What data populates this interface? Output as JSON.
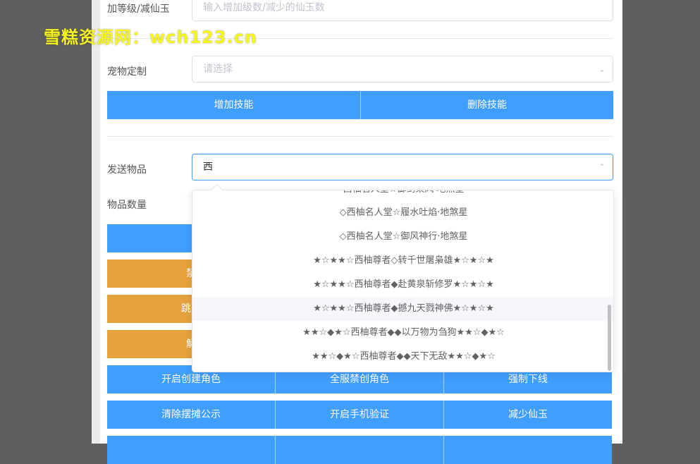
{
  "form": {
    "level_label": "加等级/减仙玉",
    "level_placeholder": "输入增加级数/减少的仙玉数",
    "pet_label": "宠物定制",
    "pet_placeholder": "请选择",
    "add_skill": "增加技能",
    "delete_skill": "删除技能",
    "send_item_label": "发送物品",
    "send_item_value": "西",
    "item_qty_label": "物品数量"
  },
  "dropdown": {
    "options": [
      "西柚名人堂☆御剑乘风·地煞星",
      "◇西柚名人堂☆履水吐焰·地煞星",
      "◇西柚名人堂☆御风神行·地煞星",
      "★☆★★☆西柚尊者◇转千世屠枭雄★☆★☆★",
      "★☆★★☆西柚尊者◆赴黄泉斩修罗★☆★☆★",
      "★☆★★☆西柚尊者◆撼九天戮神佛★☆★☆★",
      "★★☆◆★☆西柚尊者◆◆以万物为刍狗★★☆◆★☆",
      "★★☆◆★☆西柚尊者◆◆天下无敌★★☆◆★☆"
    ]
  },
  "hidden_buttons": {
    "b1": "禁",
    "b2": "跳过",
    "b3": "解"
  },
  "buttons": {
    "row1": [
      "开启创建角色",
      "全服禁创角色",
      "强制下线"
    ],
    "row2": [
      "清除摆摊公示",
      "开启手机验证",
      "减少仙玉"
    ]
  },
  "watermark": "雪糕资源网：wch123.cn",
  "colors": {
    "primary": "#409eff",
    "warning": "#e6a23c"
  }
}
